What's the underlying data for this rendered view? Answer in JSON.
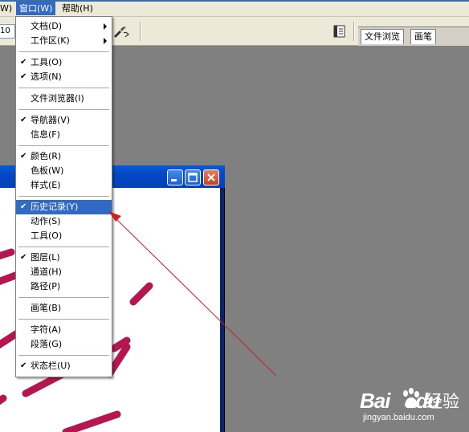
{
  "menubar": {
    "items": [
      {
        "label": "W)"
      },
      {
        "label": "窗口(W)"
      },
      {
        "label": "帮助(H)"
      }
    ]
  },
  "options_bar": {
    "size_value": "10"
  },
  "palette_well": {
    "tabs": [
      {
        "label": "文件浏览"
      },
      {
        "label": "画笔"
      }
    ]
  },
  "window_menu": {
    "groups": [
      [
        {
          "label": "文档(D)",
          "submenu": true
        },
        {
          "label": "工作区(K)",
          "submenu": true
        }
      ],
      [
        {
          "label": "工具(O)",
          "checked": true
        },
        {
          "label": "选项(N)",
          "checked": true
        }
      ],
      [
        {
          "label": "文件浏览器(I)"
        }
      ],
      [
        {
          "label": "导航器(V)",
          "checked": true
        },
        {
          "label": "信息(F)"
        }
      ],
      [
        {
          "label": "颜色(R)",
          "checked": true
        },
        {
          "label": "色板(W)"
        },
        {
          "label": "样式(E)"
        }
      ],
      [
        {
          "label": "历史记录(Y)",
          "checked": true,
          "highlighted": true
        },
        {
          "label": "动作(S)"
        },
        {
          "label": "工具(O)"
        }
      ],
      [
        {
          "label": "图层(L)",
          "checked": true
        },
        {
          "label": "通道(H)"
        },
        {
          "label": "路径(P)"
        }
      ],
      [
        {
          "label": "画笔(B)"
        }
      ],
      [
        {
          "label": "字符(A)"
        },
        {
          "label": "段落(G)"
        }
      ],
      [
        {
          "label": "状态栏(U)",
          "checked": true
        }
      ]
    ]
  },
  "check_glyph": "✔",
  "watermark": {
    "brand": "Bai",
    "brand2": "du",
    "cn": "经验",
    "url": "jingyan.baidu.com"
  },
  "colors": {
    "highlight": "#316ac5",
    "stroke": "#b5164f",
    "arrow": "#cc2222",
    "workspace": "#808080"
  }
}
